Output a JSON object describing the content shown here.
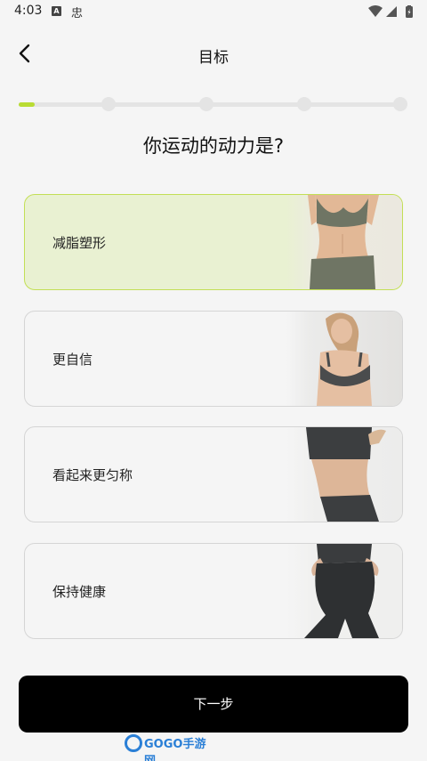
{
  "status_bar": {
    "time": "4:03",
    "icon_a_text": "A",
    "icon_b_text": "忠"
  },
  "header": {
    "title": "目标"
  },
  "progress": {
    "step": 1,
    "total_steps": 5,
    "fill_fraction": 0.04,
    "accent_color": "#b9dc34"
  },
  "question": "你运动的动力是?",
  "options": [
    {
      "label": "减脂塑形",
      "selected": true
    },
    {
      "label": "更自信",
      "selected": false
    },
    {
      "label": "看起来更匀称",
      "selected": false
    },
    {
      "label": "保持健康",
      "selected": false
    }
  ],
  "next_button": {
    "label": "下一步"
  },
  "watermark": {
    "text": "GOGO手游网"
  }
}
